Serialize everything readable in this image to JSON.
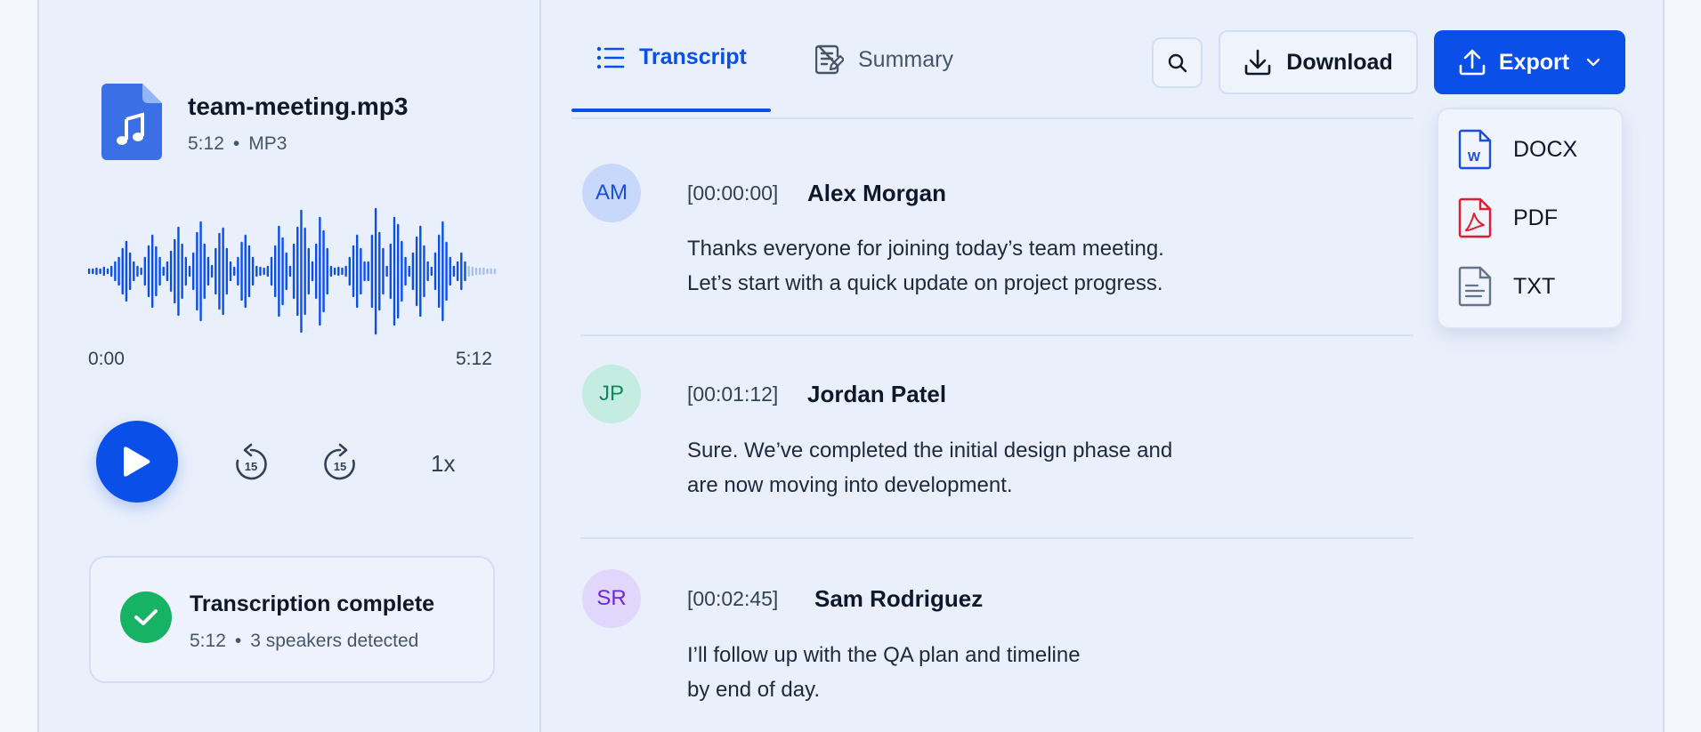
{
  "file": {
    "name": "team-meeting.mp3",
    "duration": "5:12",
    "format": "MP3"
  },
  "player": {
    "time_start": "0:00",
    "time_end": "5:12",
    "skip_back": "15",
    "skip_forward": "15",
    "speed": "1x",
    "progress": 0.92
  },
  "status": {
    "title": "Transcription complete",
    "duration": "5:12",
    "speakers": "3 speakers detected"
  },
  "tabs": [
    {
      "label": "Transcript",
      "active": true
    },
    {
      "label": "Summary",
      "active": false
    }
  ],
  "toolbar": {
    "download_label": "Download",
    "export_label": "Export"
  },
  "export_menu": [
    {
      "label": "DOCX",
      "icon": "docx-file-icon"
    },
    {
      "label": "PDF",
      "icon": "pdf-file-icon"
    },
    {
      "label": "TXT",
      "icon": "txt-file-icon"
    }
  ],
  "transcript": [
    {
      "initials": "AM",
      "timestamp": "[00:00:00]",
      "speaker": "Alex Morgan",
      "line1": "Thanks everyone for joining today’s team meeting.",
      "line2": "Let’s start with a quick update on project progress."
    },
    {
      "initials": "JP",
      "timestamp": "[00:01:12]",
      "speaker": "Jordan Patel",
      "line1": "Sure. We’ve completed the initial design phase and",
      "line2": "are now moving into development."
    },
    {
      "initials": "SR",
      "timestamp": "[00:02:45]",
      "speaker": "Sam Rodriguez",
      "line1": "I’ll follow up with the QA plan and timeline",
      "line2": "by end of day."
    }
  ],
  "colors": {
    "accent": "#0a4fe8",
    "success": "#16b364",
    "pdf_red": "#e11d2e"
  }
}
